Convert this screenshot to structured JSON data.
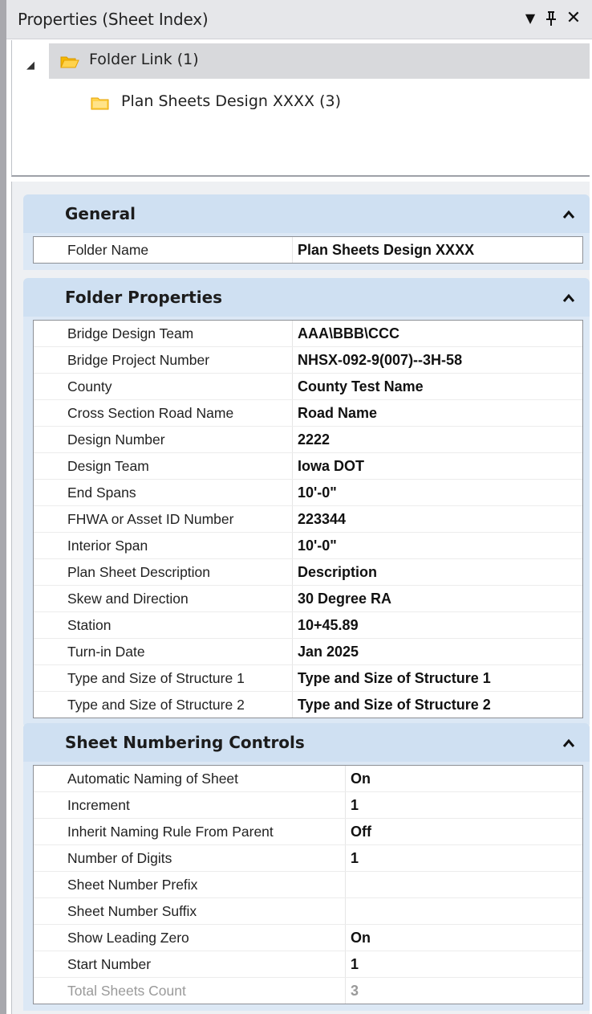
{
  "window": {
    "title": "Properties (Sheet Index)",
    "dropdown_glyph": "▼",
    "pin_glyph": "ᵽ",
    "close_glyph": "✕"
  },
  "tree": {
    "expander_glyph": "◢",
    "root": {
      "label": "Folder Link (1)",
      "icon": "open-folder-icon"
    },
    "child": {
      "label": "Plan Sheets Design XXXX (3)",
      "icon": "folder-icon"
    }
  },
  "sections": {
    "general": {
      "title": "General",
      "collapse_glyph": "⌃",
      "rows": [
        {
          "name": "Folder Name",
          "value": "Plan Sheets Design XXXX"
        }
      ]
    },
    "folder_properties": {
      "title": "Folder Properties",
      "collapse_glyph": "⌃",
      "rows": [
        {
          "name": "Bridge Design Team",
          "value": "AAA\\BBB\\CCC"
        },
        {
          "name": "Bridge Project Number",
          "value": "NHSX-092-9(007)--3H-58"
        },
        {
          "name": "County",
          "value": "County Test Name"
        },
        {
          "name": "Cross Section Road Name",
          "value": "Road Name"
        },
        {
          "name": "Design Number",
          "value": "2222"
        },
        {
          "name": "Design Team",
          "value": "Iowa DOT"
        },
        {
          "name": "End Spans",
          "value": "10'-0\""
        },
        {
          "name": "FHWA or Asset ID Number",
          "value": "223344"
        },
        {
          "name": "Interior Span",
          "value": "10'-0\""
        },
        {
          "name": "Plan Sheet Description",
          "value": "Description"
        },
        {
          "name": "Skew and Direction",
          "value": "30 Degree RA"
        },
        {
          "name": "Station",
          "value": "10+45.89"
        },
        {
          "name": "Turn-in Date",
          "value": "Jan 2025"
        },
        {
          "name": "Type and Size of Structure 1",
          "value": "Type and Size of Structure 1"
        },
        {
          "name": "Type and Size of Structure 2",
          "value": "Type and Size of Structure 2"
        }
      ]
    },
    "sheet_numbering": {
      "title": "Sheet Numbering Controls",
      "collapse_glyph": "⌃",
      "rows": [
        {
          "name": "Automatic Naming of Sheet",
          "value": "On"
        },
        {
          "name": "Increment",
          "value": "1"
        },
        {
          "name": "Inherit Naming Rule From Parent",
          "value": "Off"
        },
        {
          "name": "Number of Digits",
          "value": "1"
        },
        {
          "name": "Sheet Number Prefix",
          "value": ""
        },
        {
          "name": "Sheet Number Suffix",
          "value": ""
        },
        {
          "name": "Show Leading Zero",
          "value": "On"
        },
        {
          "name": "Start Number",
          "value": "1"
        },
        {
          "name": "Total Sheets Count",
          "value": "3"
        }
      ]
    }
  }
}
